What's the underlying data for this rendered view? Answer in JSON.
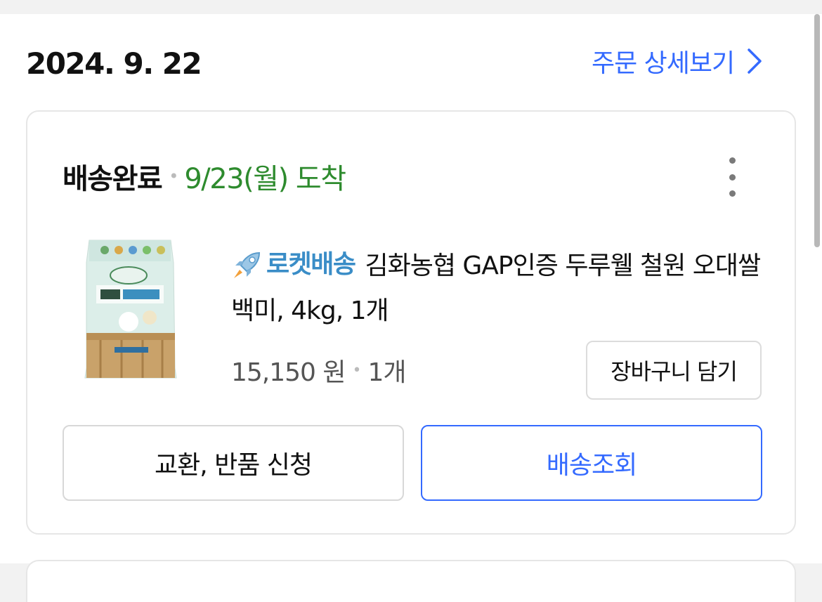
{
  "order": {
    "date": "2024. 9. 22",
    "detail_link": "주문 상세보기"
  },
  "card": {
    "status": "배송완료",
    "arrival": "9/23(월) 도착",
    "product": {
      "badge": "로켓배송",
      "title": "김화농협 GAP인증 두루웰 철원 오대쌀 백미, 4kg, 1개",
      "price": "15,150 원",
      "quantity": "1개"
    },
    "cart_button": "장바구니 담기",
    "return_button": "교환, 반품 신청",
    "track_button": "배송조회"
  },
  "colors": {
    "accent": "#346aff",
    "arrival_green": "#2e8b2e",
    "rocket_blue": "#3a8dc7"
  },
  "icons": [
    "chevron-right-icon",
    "more-vertical-icon",
    "rocket-icon"
  ]
}
